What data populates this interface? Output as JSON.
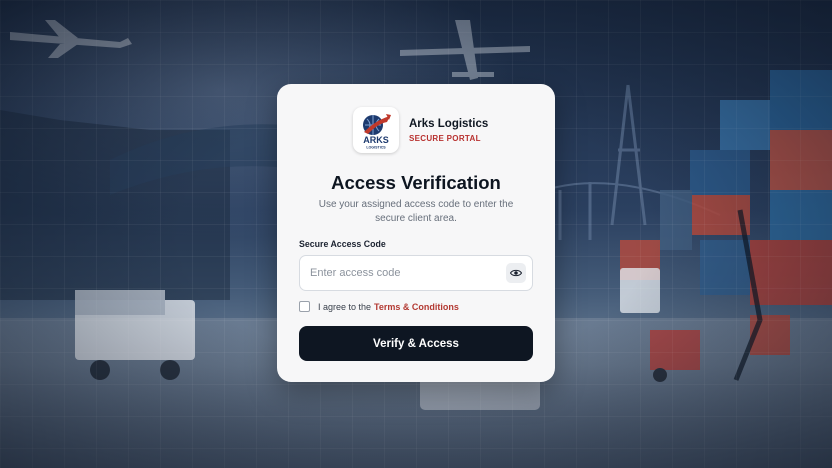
{
  "brand": {
    "name": "Arks Logistics",
    "subtitle": "SECURE PORTAL",
    "logo_text": "ARKS",
    "logo_subtext": "LOGISTICS",
    "accent_color": "#b8312f",
    "logo_navy": "#1d3a6e"
  },
  "verification": {
    "title": "Access Verification",
    "description": "Use your assigned access code to enter the secure client area."
  },
  "access_code": {
    "label": "Secure Access Code",
    "placeholder": "Enter access code",
    "value": "",
    "toggle_icon": "eye-icon"
  },
  "terms": {
    "checked": false,
    "prefix": "I agree to the",
    "link_text": "Terms & Conditions"
  },
  "submit": {
    "label": "Verify & Access",
    "color": "#0e1622"
  }
}
